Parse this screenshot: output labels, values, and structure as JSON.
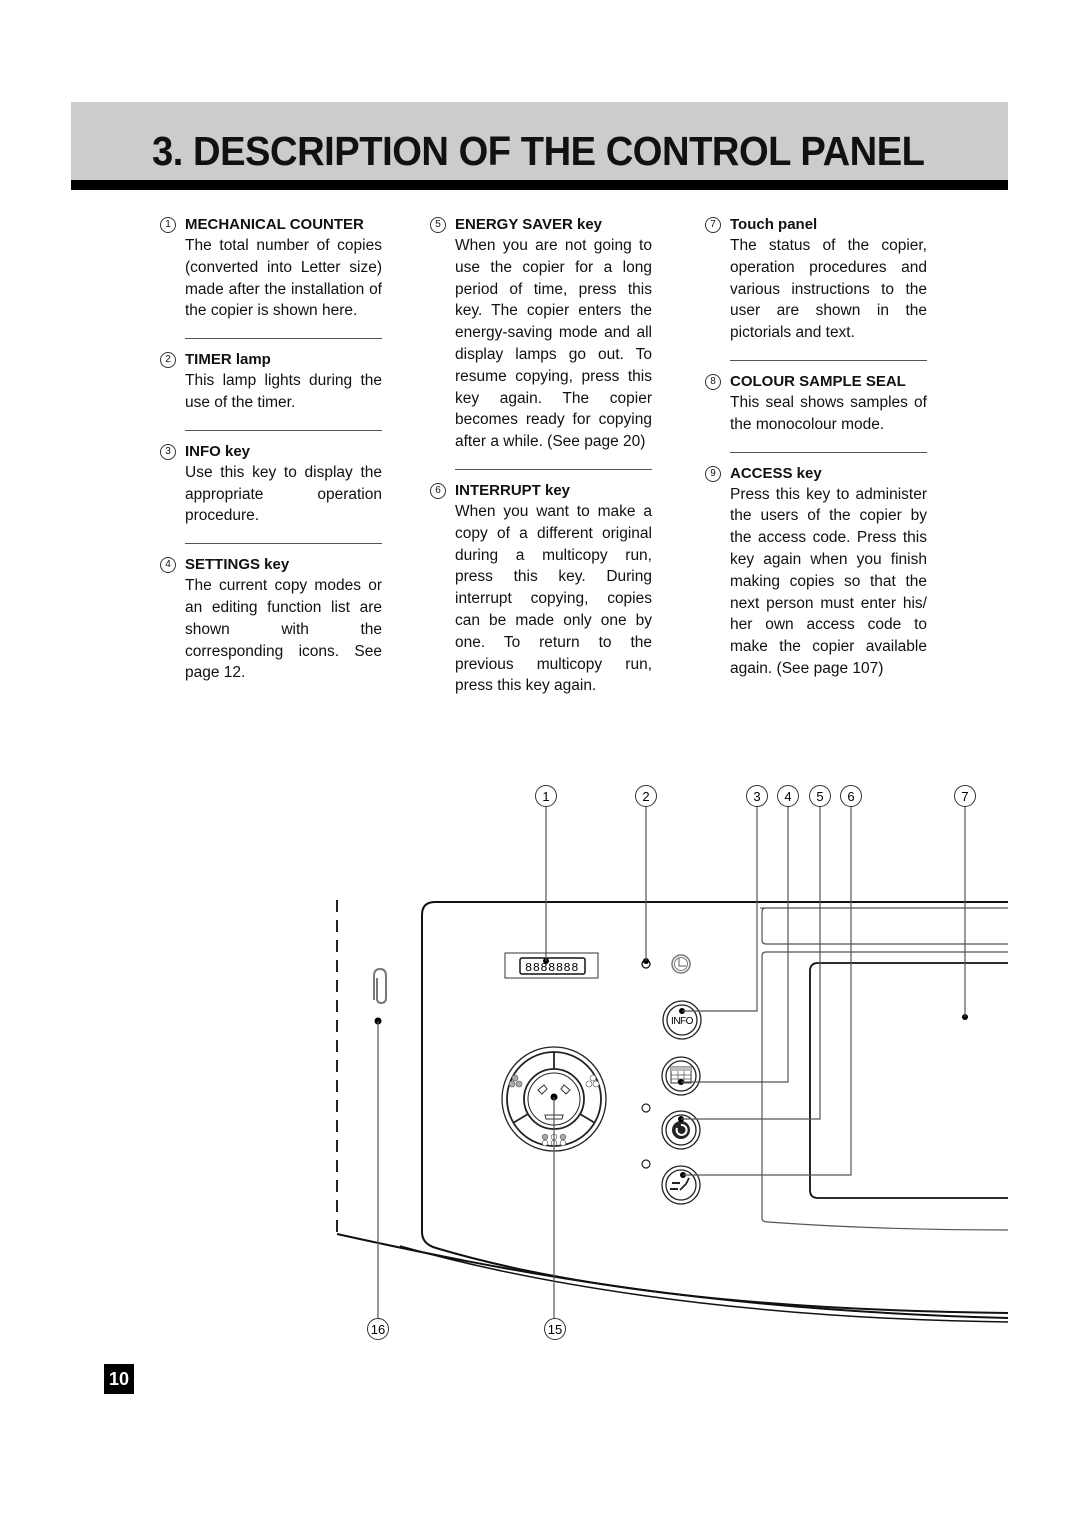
{
  "header": {
    "title": "3. DESCRIPTION OF THE CONTROL PANEL"
  },
  "descriptions": [
    {
      "num": "1",
      "heading": "MECHANICAL COUNTER",
      "text": "The total number of copies (converted into Letter size) made after the installation of the copier is shown here."
    },
    {
      "num": "2",
      "heading": "TIMER lamp",
      "text": "This lamp lights during the use of the timer."
    },
    {
      "num": "3",
      "heading": "INFO key",
      "text": "Use this key to display the appropriate operation procedure."
    },
    {
      "num": "4",
      "heading": "SETTINGS key",
      "text": "The current copy modes or an editing function list are shown with the corresponding icons. See page 12."
    },
    {
      "num": "5",
      "heading": "ENERGY SAVER key",
      "text": "When you are not going to use the copier for a long period of time, press this key. The copier enters the energy-saving mode and all display lamps go out. To resume copying, press this key again. The copier becomes ready for copying after a while. (See page 20)"
    },
    {
      "num": "6",
      "heading": "INTERRUPT key",
      "text": "When you want to make a copy of a different original during a multicopy run, press this key. During interrupt copying, copies can be made only one by one. To return to the previous multicopy run, press this key again."
    },
    {
      "num": "7",
      "heading": "Touch panel",
      "text": "The status of the copier, operation procedures and various instructions to the user are shown in the pictorials and text."
    },
    {
      "num": "8",
      "heading": "COLOUR SAMPLE SEAL",
      "text": "This seal shows samples of the monocolour mode."
    },
    {
      "num": "9",
      "heading": "ACCESS key",
      "text": "Press this key to administer the users of the copier by the access code. Press this key again when you finish making copies so that the next person must enter his/ her own access code to make the copier available again. (See page 107)"
    }
  ],
  "diagram": {
    "callouts_top": [
      "1",
      "2",
      "3",
      "4",
      "5",
      "6",
      "7"
    ],
    "callouts_bottom": [
      "16",
      "15"
    ],
    "counter_display": "8888888",
    "info_key_label": "INFO",
    "icons": [
      "paperclip-icon",
      "timer-clock-icon",
      "info-key-icon",
      "settings-key-icon",
      "energy-saver-key-icon",
      "interrupt-key-icon",
      "colour-dial-icon"
    ]
  },
  "footer": {
    "page_number": "10"
  }
}
